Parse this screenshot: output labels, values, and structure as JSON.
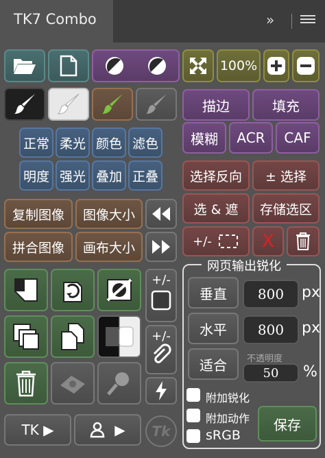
{
  "panel": {
    "title": "TK7 Combo",
    "expand_glyph": "»",
    "menu_icon": "hamburger-icon"
  },
  "toolbar": {
    "zoom_label": "100%",
    "stroke_label": "描边",
    "fill_label": "填充",
    "blur_label": "模糊",
    "acr_label": "ACR",
    "caf_label": "CAF"
  },
  "blend_modes": [
    "正常",
    "柔光",
    "颜色",
    "滤色",
    "明度",
    "强光",
    "叠加",
    "正叠"
  ],
  "image_actions": [
    "复制图像",
    "图像大小",
    "拼合图像",
    "画布大小"
  ],
  "selection": {
    "invert_label": "选择反向",
    "toggle_label": "± 选择",
    "select_mask_label": "选 & 遮",
    "save_selection_label": "存储选区",
    "plusminus_label": "+/-",
    "delete_label": "X"
  },
  "layer_tools": {
    "plusminus_top": "+/-",
    "plusminus_bottom": "+/-"
  },
  "footer": {
    "tk_label": "TK ▶",
    "user_label": "▶",
    "logo_text": "Tk"
  },
  "web_export": {
    "title": "网页输出锐化",
    "vertical_label": "垂直",
    "vertical_value": "800",
    "vertical_unit": "px",
    "horizontal_label": "水平",
    "horizontal_value": "800",
    "horizontal_unit": "px",
    "fit_label": "适合",
    "opacity_label": "不透明度",
    "opacity_value": "50",
    "opacity_unit": "%",
    "add_sharpen_label": "附加锐化",
    "add_action_label": "附加动作",
    "srgb_label": "sRGB",
    "save_label": "保存"
  },
  "colors": {
    "brush_green": "#7dc242",
    "delete_red": "#e02020"
  }
}
